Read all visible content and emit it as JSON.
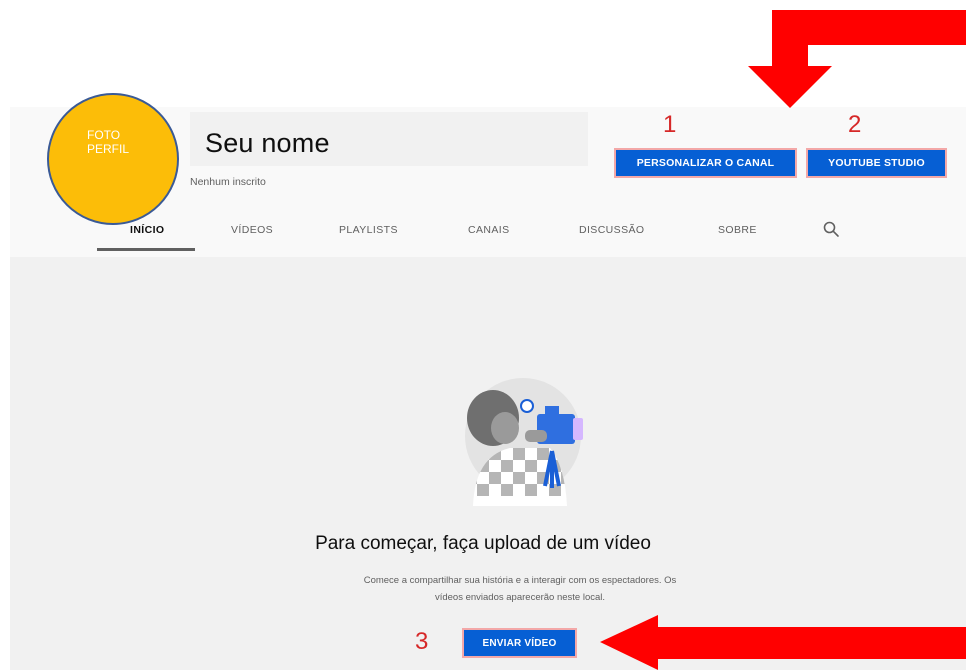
{
  "header": {
    "avatar_text": "FOTO\nPERFIL",
    "channel_name": "Seu nome",
    "subscribers": "Nenhum inscrito",
    "personalizar_label": "PERSONALIZAR O CANAL",
    "studio_label": "YOUTUBE STUDIO"
  },
  "tabs": [
    {
      "label": "INÍCIO",
      "active": true
    },
    {
      "label": "VÍDEOS"
    },
    {
      "label": "PLAYLISTS"
    },
    {
      "label": "CANAIS"
    },
    {
      "label": "DISCUSSÃO"
    },
    {
      "label": "SOBRE"
    }
  ],
  "empty_state": {
    "title": "Para começar, faça upload de um vídeo",
    "subtitle_line1": "Comece a compartilhar sua história e a interagir com os espectadores. Os",
    "subtitle_line2": "vídeos enviados aparecerão neste local.",
    "upload_label": "ENVIAR VÍDEO"
  },
  "annotations": {
    "num1": "1",
    "num2": "2",
    "num3": "3",
    "arrow_color": "#ff0000",
    "number_color": "#d62828"
  },
  "colors": {
    "button_blue": "#065fd4",
    "avatar_yellow": "#fcbd08",
    "avatar_border": "#3a5a96"
  },
  "icons": {
    "search": "search-icon",
    "illustration": "video-camera-person-illustration"
  }
}
